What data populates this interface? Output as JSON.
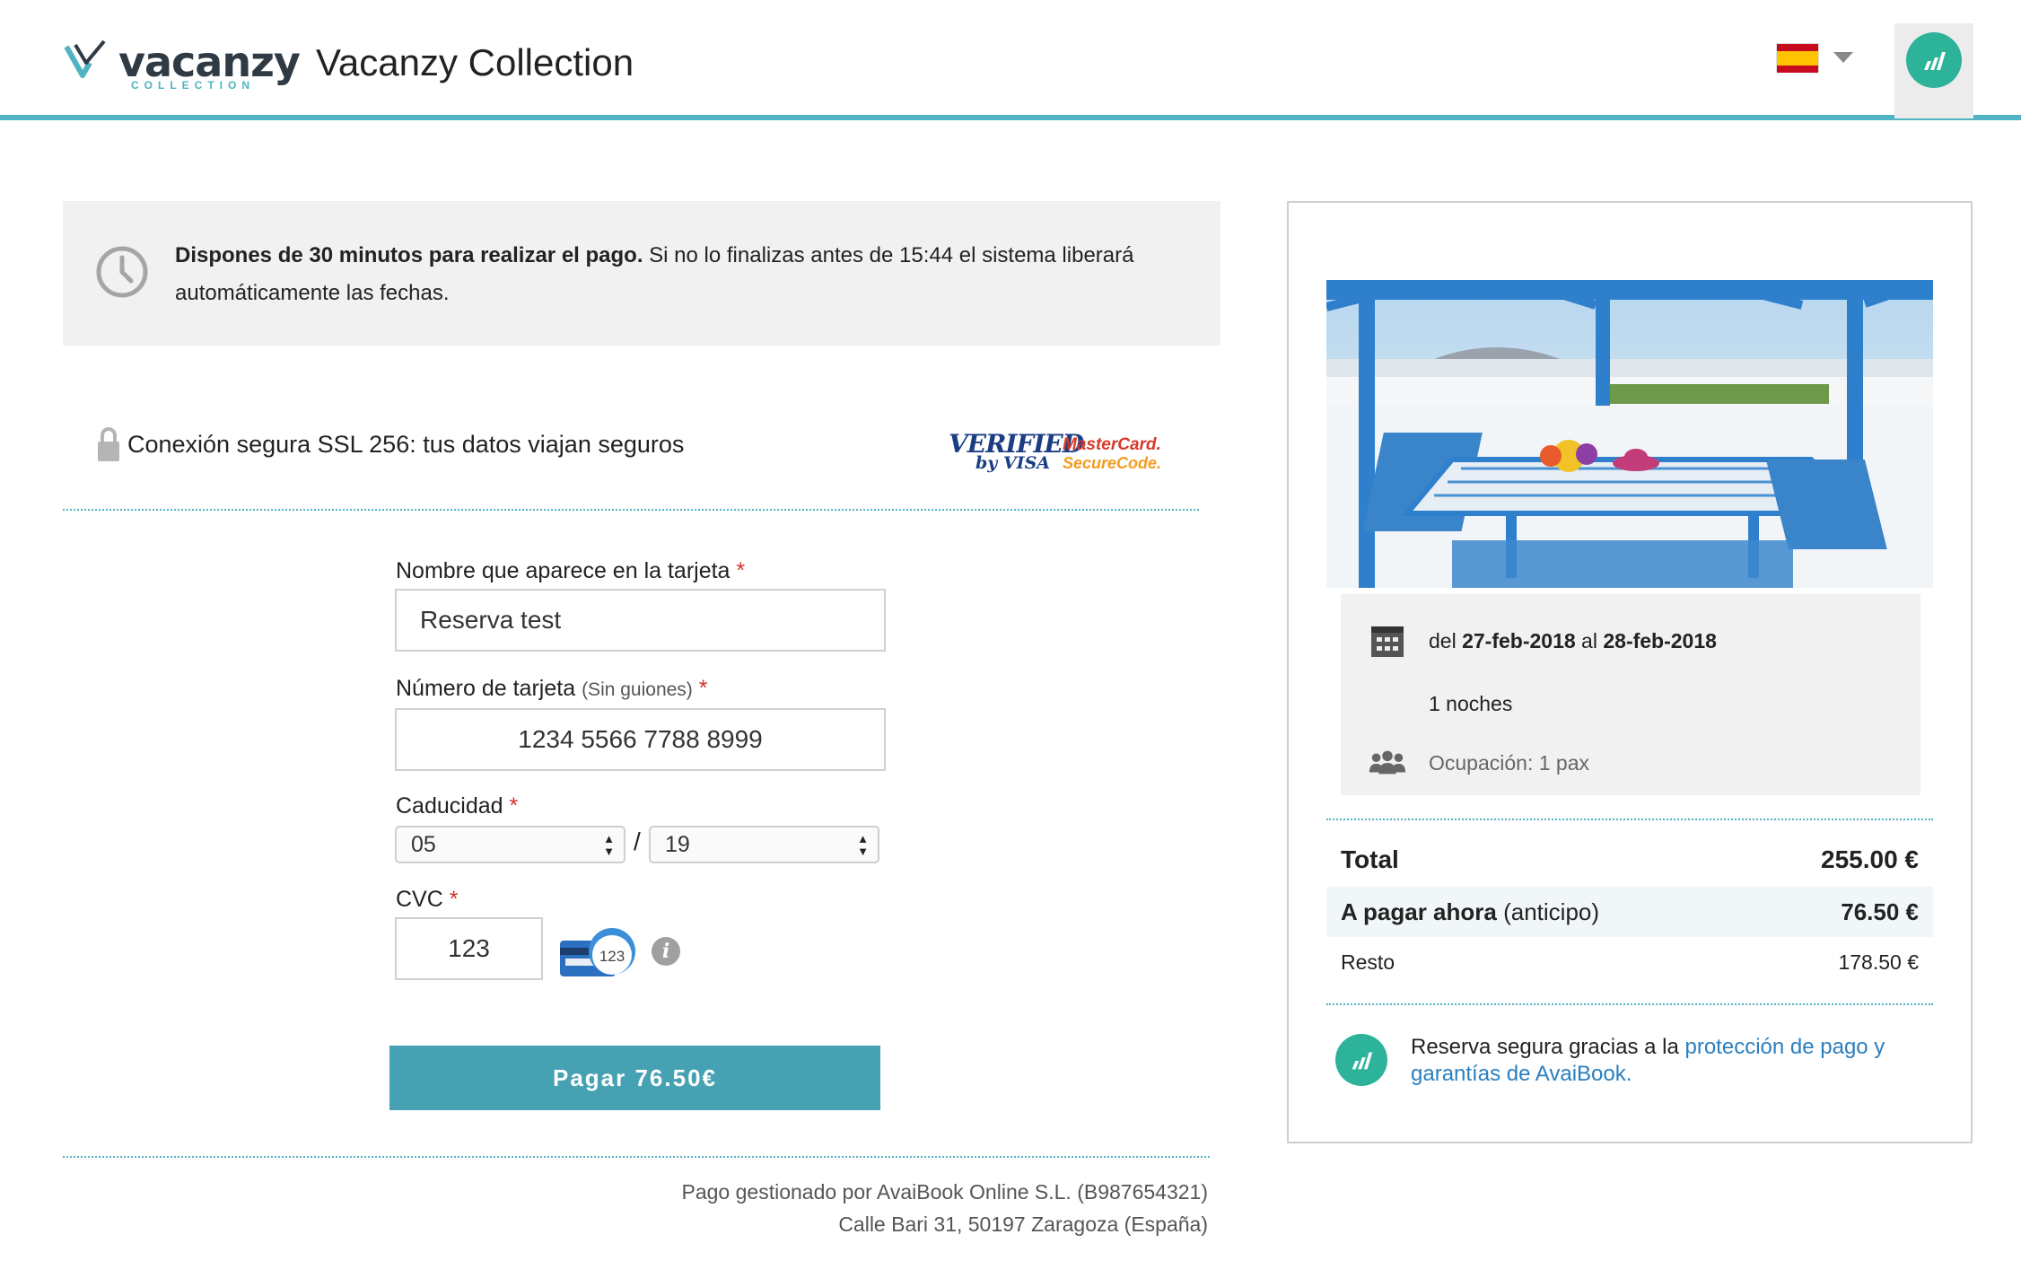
{
  "header": {
    "logo_word": "vacanzy",
    "logo_sub": "COLLECTION",
    "site_title": "Vacanzy Collection",
    "language_flag": "spain-flag-icon"
  },
  "timer": {
    "bold": "Dispones de 30 minutos para realizar el pago.",
    "rest": " Si no lo finalizas antes de 15:44 el sistema liberará automáticamente las fechas."
  },
  "secure": {
    "text": "Conexión segura SSL 256: tus datos viajan seguros",
    "verified_1": "VERIFIED",
    "verified_2": "by VISA",
    "mc_1": "MasterCard.",
    "mc_2": "SecureCode."
  },
  "form": {
    "name_label": "Nombre que aparece en la tarjeta",
    "name_value": "Reserva test",
    "card_label": "Número de tarjeta",
    "card_hint": "(Sin guiones)",
    "card_value": "1234 5566 7788 8999",
    "expiry_label": "Caducidad",
    "expiry_month": "05",
    "expiry_sep": "/",
    "expiry_year": "19",
    "cvc_label": "CVC",
    "cvc_value": "123",
    "cvc_card_hint": "123",
    "required_mark": "*",
    "pay_button": "Pagar 76.50€"
  },
  "footer": {
    "line1": "Pago gestionado por AvaiBook Online S.L. (B987654321)",
    "line2": "Calle Bari 31, 50197 Zaragoza (España)"
  },
  "summary": {
    "dates_prefix": "del ",
    "date_from": "27-feb-2018",
    "dates_mid": " al ",
    "date_to": "28-feb-2018",
    "nights": "1 noches",
    "occupancy": "Ocupación: 1 pax",
    "total_label": "Total",
    "total_value": "255.00 €",
    "now_label": "A pagar ahora",
    "now_hint": " (anticipo)",
    "now_value": "76.50 €",
    "rest_label": "Resto",
    "rest_value": "178.50 €",
    "guarantee_text": "Reserva segura gracias a la ",
    "guarantee_link": "protección de pago y garantías de AvaiBook."
  },
  "colors": {
    "accent": "#4fb3c2",
    "button": "#46a1b2",
    "avaibook_green": "#2cb39a",
    "link": "#2a7fbf",
    "required": "#d0342c"
  }
}
